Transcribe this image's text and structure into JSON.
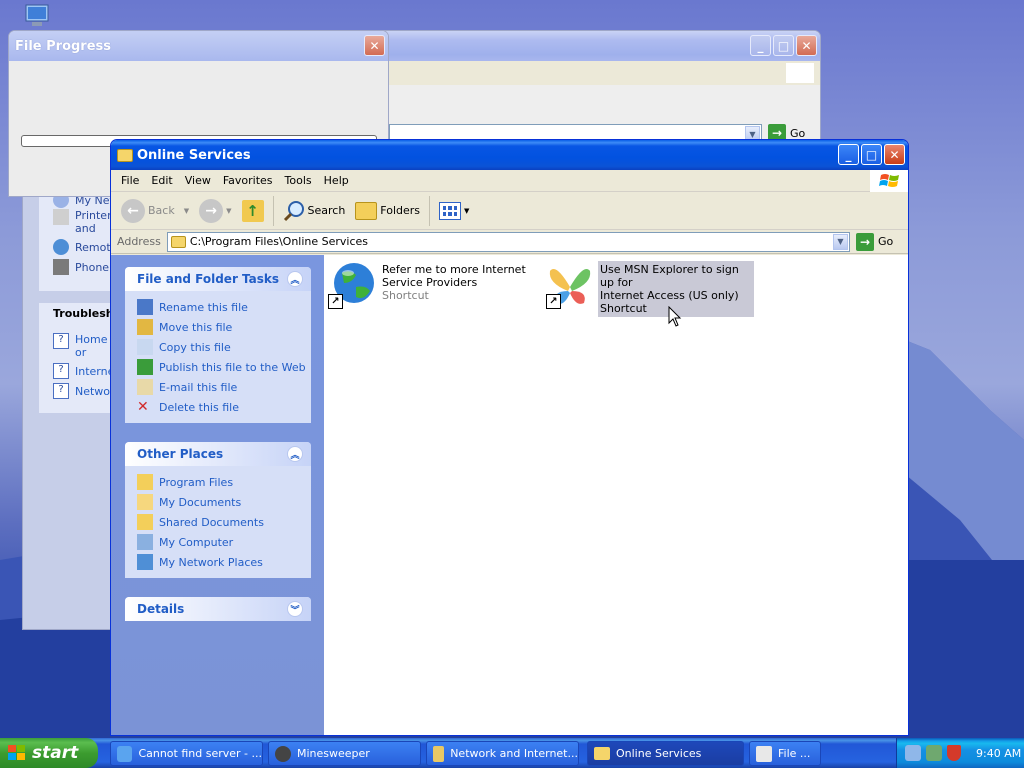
{
  "back_window": {
    "go_label": "Go",
    "side_items": [
      "My Net...",
      "Printers and Other Hardware",
      "Remote",
      "Phone and..."
    ],
    "troubleshoot_title": "Troubleshooters",
    "troubleshoot_items": [
      "Home or Small Office Networking",
      "Internet Explorer",
      "Network Diagnostics"
    ]
  },
  "file_progress": {
    "title": "File Progress",
    "progress_fraction": 0.0
  },
  "explorer": {
    "title": "Online Services",
    "menu": [
      "File",
      "Edit",
      "View",
      "Favorites",
      "Tools",
      "Help"
    ],
    "toolbar": {
      "back": "Back",
      "search": "Search",
      "folders": "Folders"
    },
    "address_label": "Address",
    "address_value": "C:\\Program Files\\Online Services",
    "go_label": "Go",
    "tasks_panel": {
      "title": "File and Folder Tasks",
      "items": [
        {
          "label": "Rename this file",
          "icon": "rename-icon"
        },
        {
          "label": "Move this file",
          "icon": "move-icon"
        },
        {
          "label": "Copy this file",
          "icon": "copy-icon"
        },
        {
          "label": "Publish this file to the Web",
          "icon": "publish-icon"
        },
        {
          "label": "E-mail this file",
          "icon": "email-icon"
        },
        {
          "label": "Delete this file",
          "icon": "delete-icon"
        }
      ]
    },
    "places_panel": {
      "title": "Other Places",
      "items": [
        {
          "label": "Program Files",
          "icon": "folder-icon"
        },
        {
          "label": "My Documents",
          "icon": "documents-icon"
        },
        {
          "label": "Shared Documents",
          "icon": "folder-icon"
        },
        {
          "label": "My Computer",
          "icon": "computer-icon"
        },
        {
          "label": "My Network Places",
          "icon": "network-icon"
        }
      ]
    },
    "details_panel": {
      "title": "Details"
    },
    "files": [
      {
        "name_line1": "Refer me to more Internet",
        "name_line2": "Service Providers",
        "type": "Shortcut",
        "selected": false
      },
      {
        "name_line1": "Use MSN Explorer to sign up for",
        "name_line2": "Internet Access (US only)",
        "type": "Shortcut",
        "selected": true
      }
    ]
  },
  "taskbar": {
    "start_label": "start",
    "tasks": [
      {
        "label": "Cannot find server - ...",
        "active": false
      },
      {
        "label": "Minesweeper",
        "active": false
      },
      {
        "label": "Network and Internet...",
        "active": false
      },
      {
        "label": "Online Services",
        "active": true
      },
      {
        "label": "File ...",
        "active": false
      }
    ],
    "clock": "9:40 AM"
  }
}
